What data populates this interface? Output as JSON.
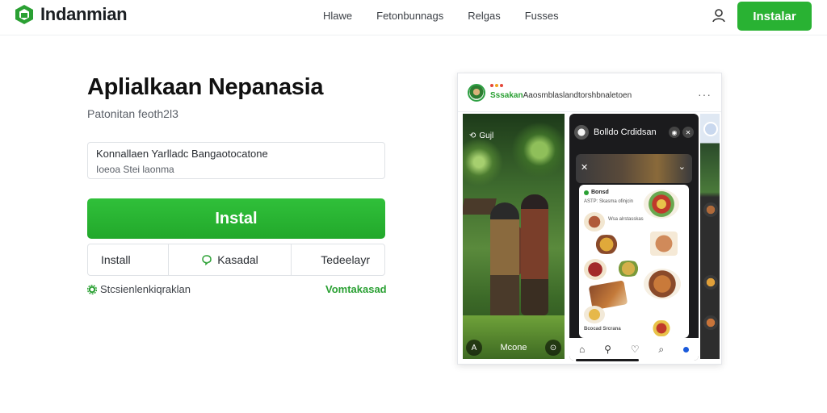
{
  "header": {
    "brand": "Indanmian",
    "nav": [
      "Hlawe",
      "Fetonbunnags",
      "Relgas",
      "Fusses"
    ],
    "install_label": "Instalar"
  },
  "main": {
    "title": "Aplialkaan Nepanasia",
    "subtitle": "Patonitan feoth2l3",
    "info_line1": "Konnallaen Yarlladc Bangaotocatone",
    "info_line2": "Ioeoa Stei laonma",
    "install_button": "Instal",
    "options": [
      "Install",
      "Kasadal",
      "Tedeelayr"
    ],
    "footer_left": "Stcsienlenkiqraklan",
    "footer_right": "Vomtakasad"
  },
  "preview": {
    "card_title_green": "Sssakan",
    "card_title_rest": "Aaosmblaslandtorshbnaletoen",
    "more": "···",
    "photo_label": "Gujl",
    "photo_bottom": "Mcone",
    "phone_header": "Bolldo Crdidsan",
    "feed_title": "Bonsd",
    "feed_sub1": "ASTP: Skasma ofinjcin",
    "feed_sub2": "Wsa alrstasskas",
    "feed_sub3": "Bcocad Srcrana"
  },
  "colors": {
    "accent": "#29b233",
    "accent_text": "#2aa033"
  },
  "icons": {
    "logo": "box-logo-icon",
    "user": "user-icon",
    "chat": "chat-icon"
  }
}
